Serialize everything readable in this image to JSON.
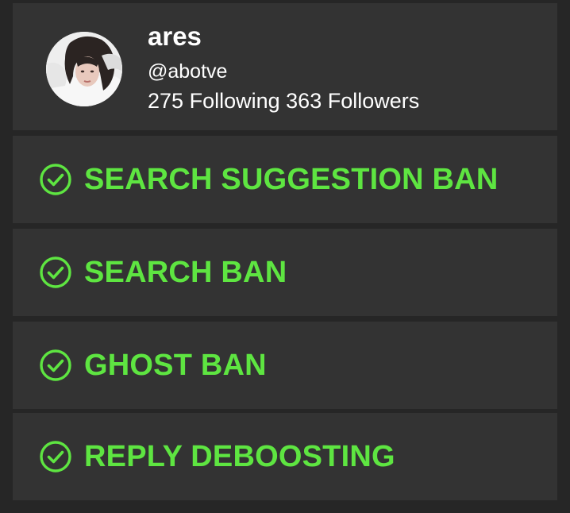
{
  "profile": {
    "display_name": "ares",
    "handle": "@abotve",
    "following_count": "275",
    "following_label": "Following",
    "followers_count": "363",
    "followers_label": "Followers",
    "avatar_icon": "user-avatar-photo"
  },
  "checks": [
    {
      "label": "SEARCH SUGGESTION BAN",
      "icon": "check-circle-icon",
      "status": "passed"
    },
    {
      "label": "SEARCH BAN",
      "icon": "check-circle-icon",
      "status": "passed"
    },
    {
      "label": "GHOST BAN",
      "icon": "check-circle-icon",
      "status": "passed"
    },
    {
      "label": "REPLY DEBOOSTING",
      "icon": "check-circle-icon",
      "status": "passed"
    }
  ],
  "colors": {
    "background": "#262626",
    "card": "#333333",
    "text": "#ffffff",
    "accent_green": "#5ee541"
  }
}
